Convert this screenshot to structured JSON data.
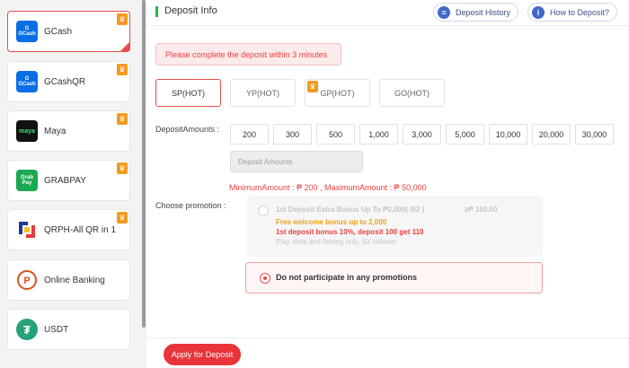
{
  "sidebar": {
    "items": [
      {
        "label": "GCash",
        "logo_text": "G\nGCash",
        "color": "#0a6ee6",
        "hot": true,
        "active": true
      },
      {
        "label": "GCashQR",
        "logo_text": "G\nGCash",
        "color": "#0a6ee6",
        "hot": true,
        "active": false
      },
      {
        "label": "Maya",
        "logo_text": "maya",
        "color": "#111111",
        "hot": true,
        "active": false
      },
      {
        "label": "GRABPAY",
        "logo_text": "Grab\nPay",
        "color": "#1aa953",
        "hot": true,
        "active": false
      },
      {
        "label": "QRPH-All QR in 1",
        "logo_text": "",
        "color": "#ffffff",
        "hot": true,
        "active": false
      },
      {
        "label": "Online Banking",
        "logo_text": "P",
        "color": "#ffffff",
        "hot": false,
        "active": false
      },
      {
        "label": "USDT",
        "logo_text": "₮",
        "color": "#26a17b",
        "hot": false,
        "active": false
      }
    ]
  },
  "header": {
    "title": "Deposit Info",
    "history_label": "Deposit History",
    "howto_label": "How to Deposit?"
  },
  "notice": "Please complete the deposit within 3 minutes",
  "channels": [
    {
      "label": "SP(HOT)",
      "active": true,
      "hot": false
    },
    {
      "label": "YP(HOT)",
      "active": false,
      "hot": false
    },
    {
      "label": "GP(HOT)",
      "active": false,
      "hot": true
    },
    {
      "label": "GO(HOT)",
      "active": false,
      "hot": false
    }
  ],
  "amounts": {
    "label": "DepositAmounts :",
    "options": [
      "200",
      "300",
      "500",
      "1,000",
      "3,000",
      "5,000",
      "10,000",
      "20,000",
      "30,000"
    ],
    "placeholder": "Deposit Amounts",
    "minmax": "MinimumAmount : ₱ 200 , MaximumAmount : ₱ 50,000"
  },
  "promotion": {
    "label": "Choose promotion :",
    "offer_title": "1st Deposit Extra Bonus Up To ₱2,000( 0/2 )",
    "offer_amount": "≥₱ 100.00",
    "offer_line1": "Free welcome bonus up to 2,000",
    "offer_line2": "1st deposit bonus 10%, deposit 100 get 110",
    "offer_line3": "Play slots and fishing only, 5X rollover",
    "none_label": "Do not participate in any promotions"
  },
  "submit_label": "Apply for Deposit"
}
